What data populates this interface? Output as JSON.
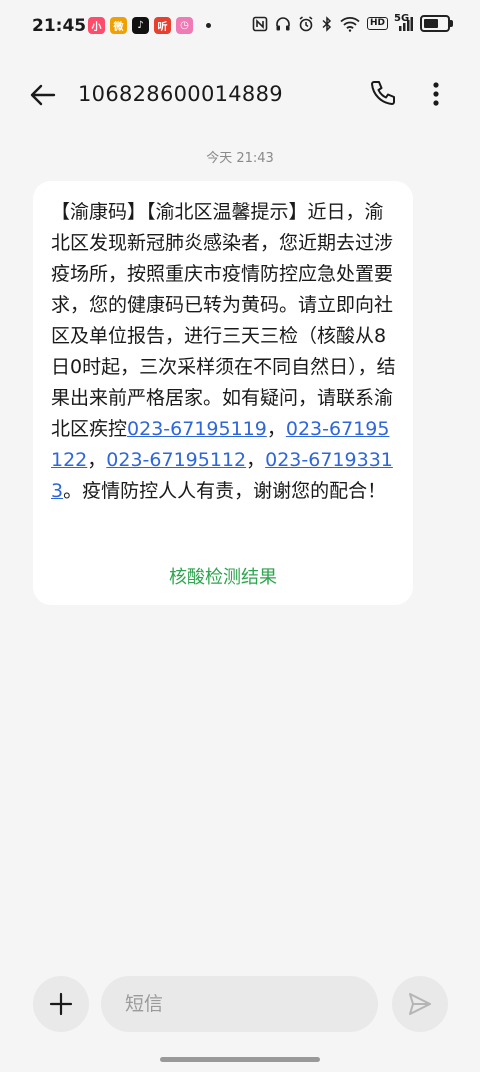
{
  "status_bar": {
    "time": "21:45",
    "app_icons": [
      {
        "name": "xiaohongshu-icon",
        "color": "#ff4c6a",
        "glyph": "小"
      },
      {
        "name": "weibo-icon",
        "color": "#f0a000",
        "glyph": "微"
      },
      {
        "name": "douyin-icon",
        "color": "#111111",
        "glyph": "♪"
      },
      {
        "name": "news-app-icon",
        "color": "#e8402e",
        "glyph": "听"
      },
      {
        "name": "alarm-app-icon",
        "color": "#f07ab6",
        "glyph": "◷"
      }
    ],
    "network": "5G",
    "hd_label": "HD",
    "battery_level": 0.65
  },
  "header": {
    "title": "106828600014889"
  },
  "conversation": {
    "timestamp": "今天 21:43",
    "message": {
      "text_1": "【渝康码】【渝北区温馨提示】近日，渝北区发现新冠肺炎感染者，您近期去过涉疫场所，按照重庆市疫情防控应急处置要求，您的健康码已转为黄码。请立即向社区及单位报告，进行三天三检（核酸从8日0时起，三次采样须在不同自然日），结果出来前严格居家。如有疑问，请联系渝北区疾控",
      "phone_1": "023-67195119",
      "sep_1": "，",
      "phone_2": "023-67195122",
      "sep_2": "，",
      "phone_3": "023-67195112",
      "sep_3": "，",
      "phone_4": "023-67193313",
      "text_2": "。疫情防控人人有责，谢谢您的配合！",
      "action_link": "核酸检测结果"
    }
  },
  "composer": {
    "placeholder": "短信"
  },
  "colors": {
    "link_blue": "#2f67d9",
    "action_green": "#2da44e",
    "background": "#f5f5f5"
  }
}
